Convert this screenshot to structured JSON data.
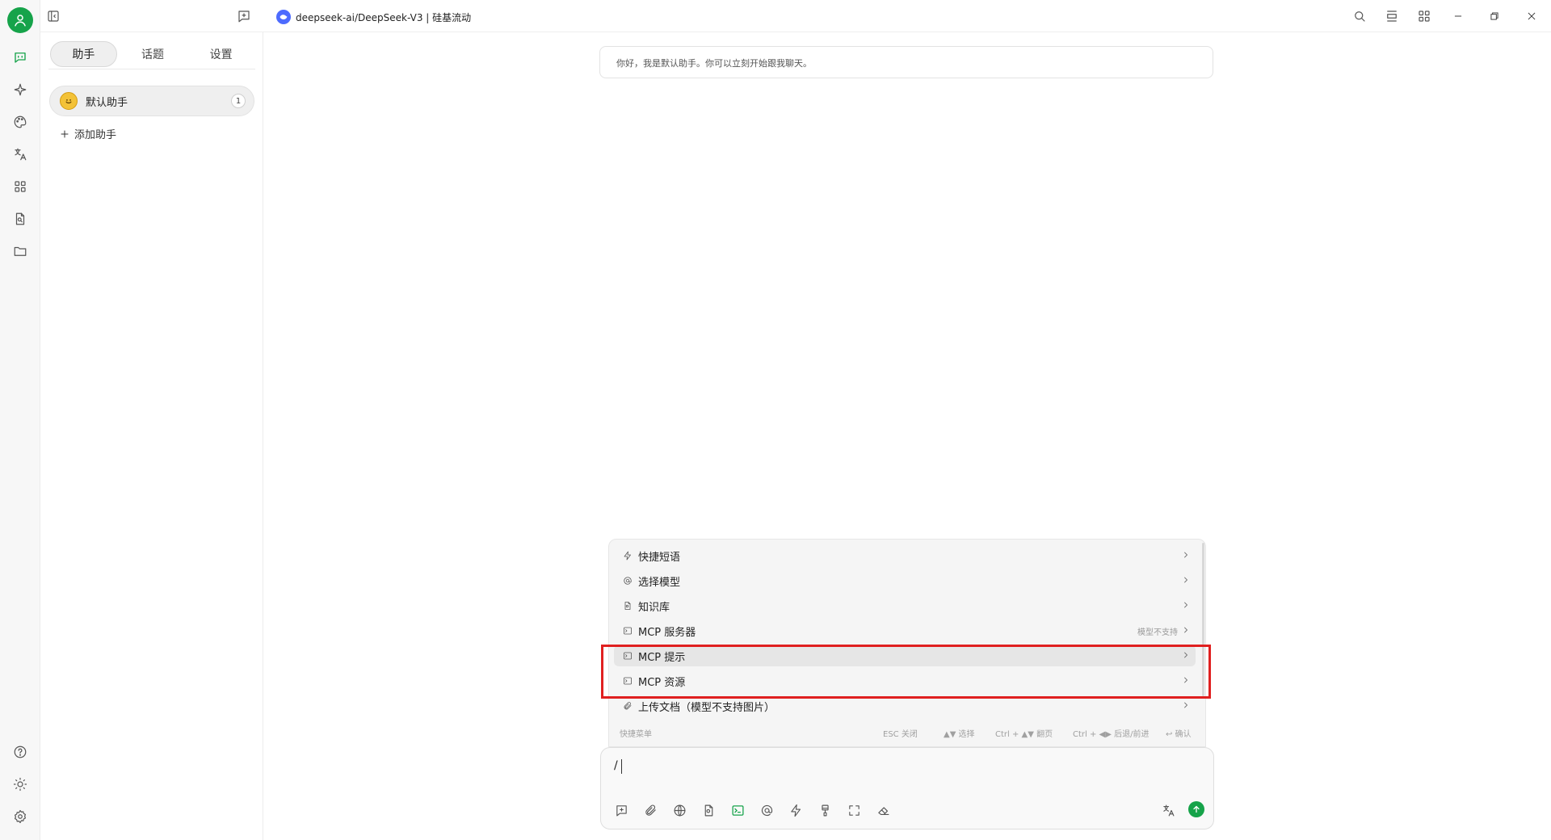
{
  "header": {
    "model_title": "deepseek-ai/DeepSeek-V3 | 硅基流动"
  },
  "sidebar": {
    "tabs": [
      {
        "label": "助手",
        "active": true
      },
      {
        "label": "话题",
        "active": false
      },
      {
        "label": "设置",
        "active": false
      }
    ],
    "assistant": {
      "name": "默认助手",
      "count": "1"
    },
    "add_assistant_label": "添加助手"
  },
  "chat": {
    "greeting": "你好，我是默认助手。你可以立刻开始跟我聊天。"
  },
  "quick_menu": {
    "items": [
      {
        "label": "快捷短语",
        "icon": "zap-icon"
      },
      {
        "label": "选择模型",
        "icon": "at-icon"
      },
      {
        "label": "知识库",
        "icon": "file-search-icon"
      },
      {
        "label": "MCP 服务器",
        "icon": "terminal-icon",
        "note": "模型不支持"
      },
      {
        "label": "MCP 提示",
        "icon": "terminal-icon",
        "highlighted": true
      },
      {
        "label": "MCP 资源",
        "icon": "terminal-icon"
      },
      {
        "label": "上传文档（模型不支持图片）",
        "icon": "paperclip-icon"
      }
    ],
    "footer": {
      "title": "快捷菜单",
      "esc": "ESC 关闭",
      "select": "▲▼ 选择",
      "page": "Ctrl + ▲▼ 翻页",
      "nav": "Ctrl + ◀▶ 后退/前进",
      "confirm": "↩ 确认"
    }
  },
  "input": {
    "value": "/"
  },
  "colors": {
    "accent": "#16a34a",
    "highlight_border": "#e02020",
    "model_logo": "#4d6bfe"
  }
}
